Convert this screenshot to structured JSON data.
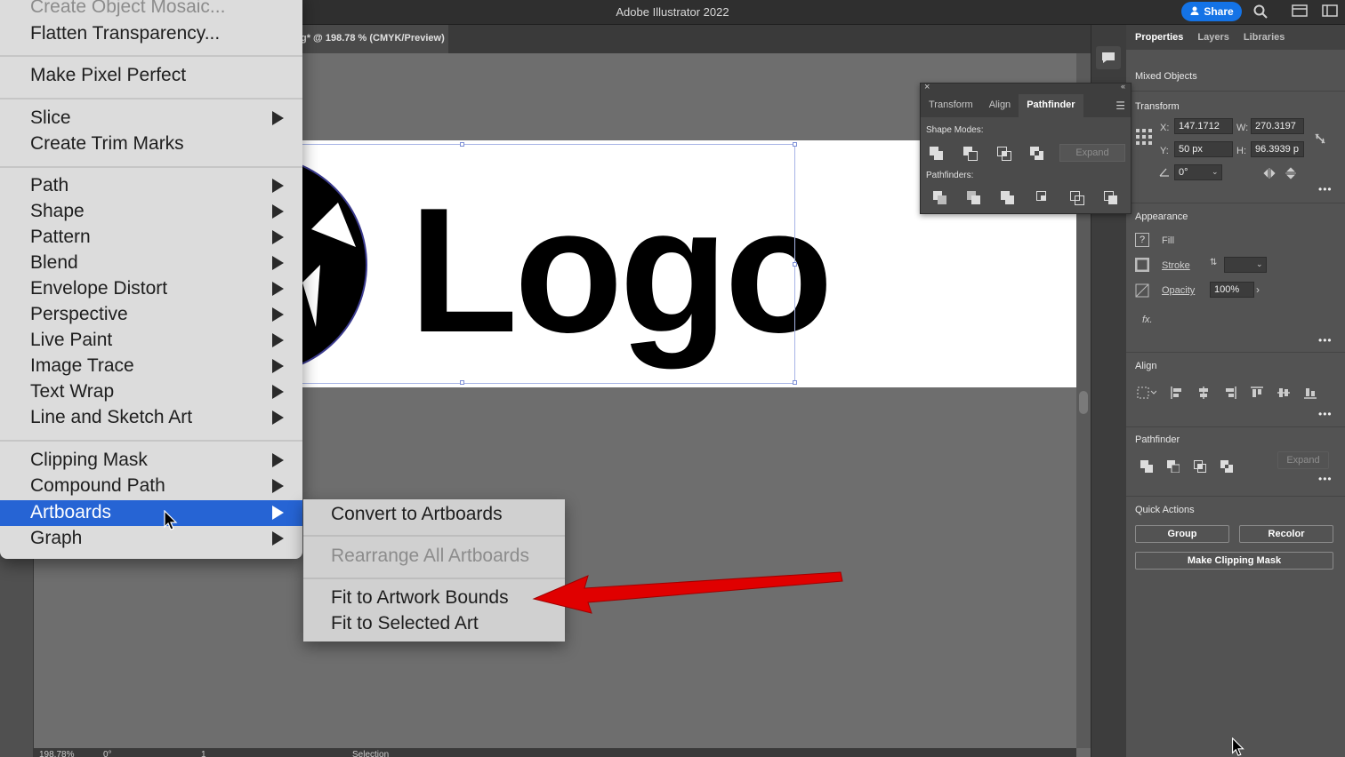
{
  "window": {
    "title": "Adobe Illustrator 2022",
    "share_label": "Share",
    "doc_tab": "g* @ 198.78 % (CMYK/Preview)"
  },
  "canvas": {
    "logo_text": "Logo"
  },
  "menu": {
    "items": [
      {
        "label": "Create Object Mosaic...",
        "disabled": true,
        "submenu": false
      },
      {
        "label": "Flatten Transparency...",
        "disabled": false,
        "submenu": false
      },
      {
        "label": "Make Pixel Perfect",
        "disabled": false,
        "submenu": false
      },
      {
        "label": "Slice",
        "disabled": false,
        "submenu": true
      },
      {
        "label": "Create Trim Marks",
        "disabled": false,
        "submenu": false
      },
      {
        "label": "Path",
        "disabled": false,
        "submenu": true
      },
      {
        "label": "Shape",
        "disabled": false,
        "submenu": true
      },
      {
        "label": "Pattern",
        "disabled": false,
        "submenu": true
      },
      {
        "label": "Blend",
        "disabled": false,
        "submenu": true
      },
      {
        "label": "Envelope Distort",
        "disabled": false,
        "submenu": true
      },
      {
        "label": "Perspective",
        "disabled": false,
        "submenu": true
      },
      {
        "label": "Live Paint",
        "disabled": false,
        "submenu": true
      },
      {
        "label": "Image Trace",
        "disabled": false,
        "submenu": true
      },
      {
        "label": "Text Wrap",
        "disabled": false,
        "submenu": true
      },
      {
        "label": "Line and Sketch Art",
        "disabled": false,
        "submenu": true
      },
      {
        "label": "Clipping Mask",
        "disabled": false,
        "submenu": true
      },
      {
        "label": "Compound Path",
        "disabled": false,
        "submenu": true
      },
      {
        "label": "Artboards",
        "disabled": false,
        "submenu": true,
        "active": true
      },
      {
        "label": "Graph",
        "disabled": false,
        "submenu": true
      }
    ]
  },
  "submenu": {
    "items": [
      {
        "label": "Convert to Artboards",
        "disabled": false
      },
      {
        "label": "Rearrange All Artboards",
        "disabled": true
      },
      {
        "label": "Fit to Artwork Bounds",
        "disabled": false
      },
      {
        "label": "Fit to Selected Art",
        "disabled": false
      }
    ]
  },
  "pathfinder_panel": {
    "tabs": [
      "Transform",
      "Align",
      "Pathfinder"
    ],
    "active_tab": "Pathfinder",
    "shape_modes_label": "Shape Modes:",
    "pathfinders_label": "Pathfinders:",
    "expand_label": "Expand"
  },
  "properties": {
    "tabs": [
      "Properties",
      "Layers",
      "Libraries"
    ],
    "active_tab": "Properties",
    "selection_type": "Mixed Objects",
    "transform": {
      "title": "Transform",
      "x_label": "X:",
      "x_value": "147.1712",
      "y_label": "Y:",
      "y_value": "50 px",
      "w_label": "W:",
      "w_value": "270.3197",
      "h_label": "H:",
      "h_value": "96.3939 p",
      "angle_value": "0°"
    },
    "appearance": {
      "title": "Appearance",
      "fill_label": "Fill",
      "stroke_label": "Stroke",
      "opacity_label": "Opacity",
      "opacity_value": "100%",
      "fx_label": "fx."
    },
    "align": {
      "title": "Align"
    },
    "pathfinder": {
      "title": "Pathfinder",
      "expand_label": "Expand"
    },
    "quick_actions": {
      "title": "Quick Actions",
      "group_label": "Group",
      "recolor_label": "Recolor",
      "clipping_mask_label": "Make Clipping Mask"
    }
  },
  "statusbar": {
    "zoom": "198.78%",
    "rotation": "0°",
    "artboard_num": "1",
    "tool": "Selection"
  },
  "colors": {
    "menu_highlight": "#2664d4",
    "annotation_arrow": "#e00000",
    "share_button": "#1473e6"
  }
}
